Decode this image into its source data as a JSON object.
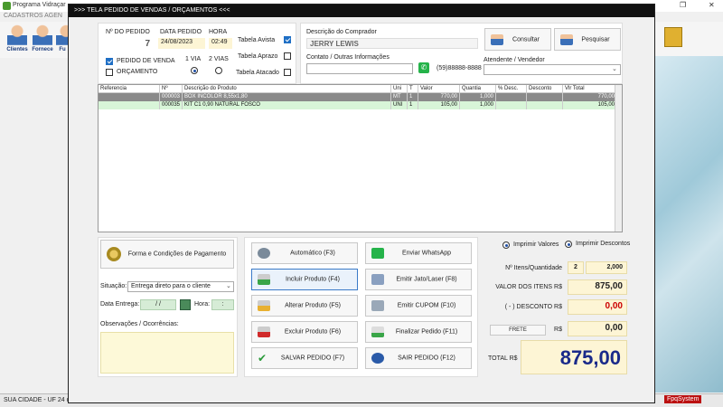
{
  "background": {
    "title": "Programa Vidraçar",
    "menu": "CADASTROS   AGEN",
    "toolbar": [
      {
        "label": "Clientes"
      },
      {
        "label": "Fornece"
      },
      {
        "label": "Fu"
      }
    ],
    "status_left": "SUA CIDADE - UF 24 de",
    "status_brand": "FpqSystem"
  },
  "modal": {
    "title": ">>>   TELA PEDIDO DE VENDAS / ORÇAMENTOS   <<<"
  },
  "order": {
    "number_label": "Nº DO PEDIDO",
    "number": "7",
    "date_label": "DATA PEDIDO",
    "date": "24/08/2023",
    "time_label": "HORA",
    "time": "02:49",
    "type_sale": "PEDIDO DE VENDA",
    "type_sale_checked": true,
    "type_quote": "ORÇAMENTO",
    "type_quote_checked": false,
    "copies_1": "1 VIA",
    "copies_2": "2 VIAS",
    "copies_selected": "1 VIA",
    "price_cash": "Tabela Avista",
    "price_cash_checked": true,
    "price_term": "Tabela Aprazo",
    "price_term_checked": false,
    "price_wholesale": "Tabela Atacado",
    "price_wholesale_checked": false
  },
  "buyer": {
    "desc_label": "Descrição do Comprador",
    "name": "JERRY LEWIS",
    "contact_label": "Contato / Outras Informações",
    "contact_value": "",
    "phone": "(59)88888-8888",
    "attendant_label": "Atendente / Vendedor",
    "attendant_value": "",
    "consult_label": "Consultar",
    "search_label": "Pesquisar"
  },
  "items_table": {
    "columns": [
      "Referencia",
      "Nº",
      "Descrição do Produto",
      "Uni",
      "T",
      "Valor",
      "Quantia",
      "% Desc.",
      "Desconto",
      "Vlr Total"
    ],
    "rows": [
      {
        "ref": "",
        "num": "000003",
        "desc": "BOX INCOLOR 8,55x1,80",
        "uni": "MT",
        "t": "1",
        "valor": "770,00",
        "quantia": "1,000",
        "pdesc": "",
        "desconto": "",
        "total": "770,00"
      },
      {
        "ref": "",
        "num": "000035",
        "desc": "KIT C1  0,90 NATURAL FOSCO",
        "uni": "UNI",
        "t": "1",
        "valor": "105,00",
        "quantia": "1,000",
        "pdesc": "",
        "desconto": "",
        "total": "105,00"
      }
    ]
  },
  "payment": {
    "button_label": "Forma e Condições de Pagamento",
    "situation_label": "Situação:",
    "situation_value": "Entrega direto para o cliente",
    "delivery_label": "Data Entrega:",
    "delivery_value": "/ /",
    "hour_label": "Hora:",
    "hour_value": ":",
    "notes_label": "Observações / Ocorrências:"
  },
  "actions": {
    "auto": "Automático     (F3)",
    "whatsapp": "Enviar WhatsApp",
    "include": "Incluir Produto  (F4)",
    "print_jet": "Emitir Jato/Laser (F8)",
    "edit": "Alterar Produto   (F5)",
    "coupon": "Emitir CUPOM   (F10)",
    "delete": "Excluir Produto   (F6)",
    "finish": "Finalizar Pedido  (F11)",
    "save": "SALVAR PEDIDO (F7)",
    "exit": "SAIR  PEDIDO  (F12)"
  },
  "totals": {
    "print_values": "Imprimir Valores",
    "print_discounts": "Imprimir Descontos",
    "print_selected": "Imprimir Descontos",
    "items_label": "Nº Itens/Quantidade",
    "items_count": "2",
    "items_qty": "2,000",
    "value_label": "VALOR DOS ITENS R$",
    "value": "875,00",
    "discount_label": "( - ) DESCONTO R$",
    "discount": "0,00",
    "freight_label": "FRETE",
    "freight_currency": "R$",
    "freight": "0,00",
    "total_label": "TOTAL R$",
    "total": "875,00"
  },
  "colors": {
    "accent": "#1f6fc5",
    "total_text": "#1a2a8a",
    "discount_text": "#cc0000",
    "value_text": "#111111"
  }
}
